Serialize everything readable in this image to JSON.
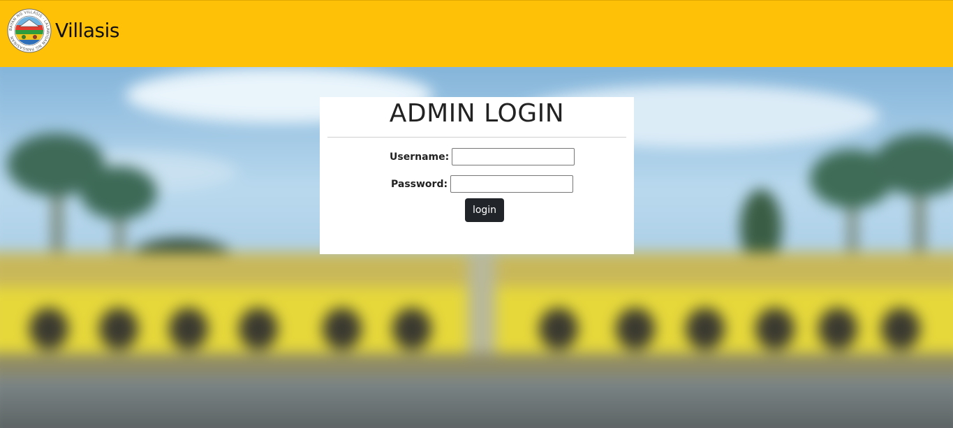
{
  "header": {
    "brand_name": "Villasis",
    "background_color": "#ffc107",
    "logo": {
      "icon": "villasis-seal-icon",
      "ring_text": "BAYAN NG VILLASIS · LALAWIGAN NG PANGASINAN"
    }
  },
  "login": {
    "title": "ADMIN LOGIN",
    "username_label": "Username:",
    "username_value": "",
    "password_label": "Password:",
    "password_value": "",
    "submit_label": "login",
    "submit_color": "#212529"
  },
  "background": {
    "description_icon": "blurred-town-hall-photo",
    "building_color": "#e6d83a",
    "sky_color": "#9ec8e6"
  }
}
